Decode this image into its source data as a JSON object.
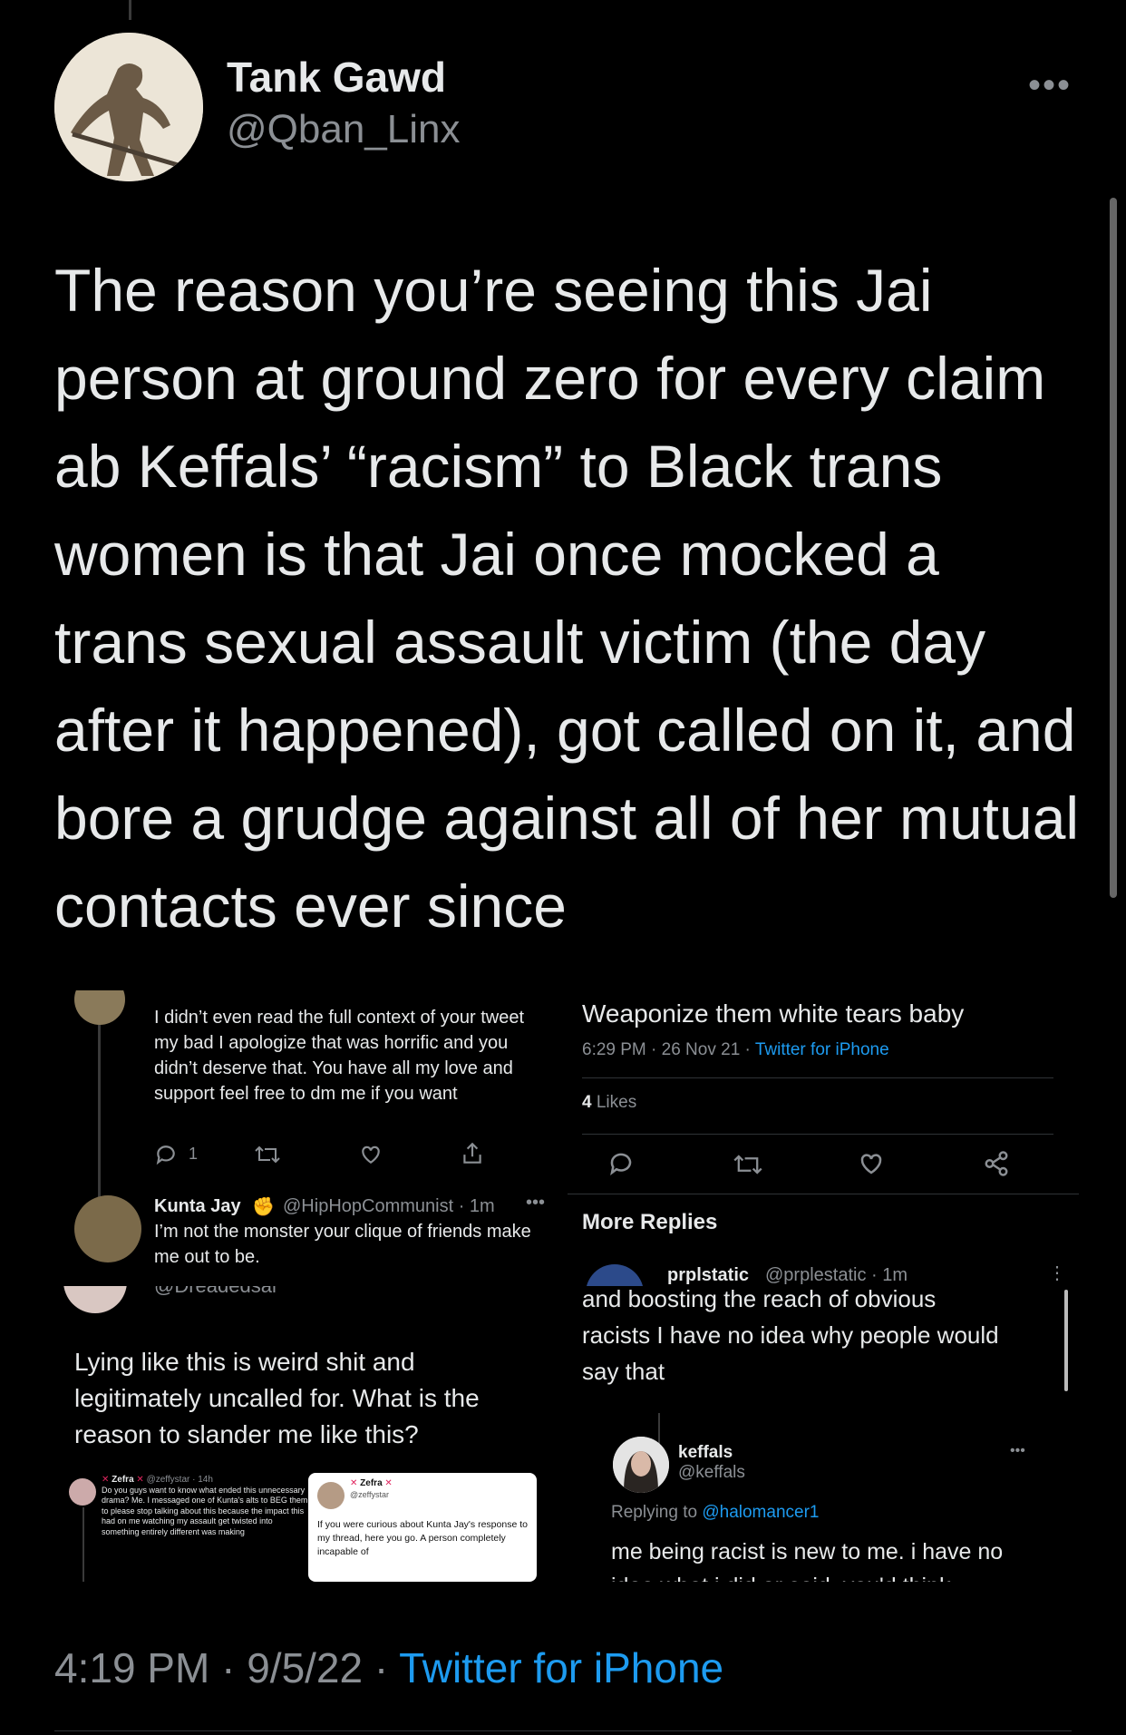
{
  "tweet": {
    "author_name": "Tank Gawd",
    "author_handle": "@Qban_Linx",
    "more": "•••",
    "text": "The reason you’re seeing this Jai person at ground zero for every claim ab Keffals’ “racism” to Black trans women is that Jai once mocked a trans sexual assault victim (the day after it happened), got called on it, and bore a grudge against all of her mutual contacts ever since",
    "time": "4:19 PM",
    "date": "9/5/22",
    "source": "Twitter for iPhone",
    "sep": "·"
  },
  "shot1": {
    "reply_text": "I didn’t even read the full context of your tweet my bad I apologize that was horrific and you didn’t deserve that. You have all my love and support feel free to dm me if you want",
    "reply_count": "1",
    "kunta_name": "Kunta Jay",
    "kunta_handle": "@HipHopCommunist · 1m",
    "kunta_more": "•••",
    "kunta_text": "I’m not the monster your clique of friends make me out to be."
  },
  "shot2": {
    "text": "Weaponize them white tears baby",
    "meta_time": "6:29 PM · 26 Nov 21 · ",
    "meta_source": "Twitter for iPhone",
    "likes_count": "4",
    "likes_label": "Likes",
    "more_replies": "More Replies",
    "prpl_name": "prplstatic",
    "prpl_handle": "@prplestatic · 1m",
    "prpl_more": "⋮"
  },
  "shot3": {
    "cut_handle": "@Dreadedsal",
    "text": "Lying like this is weird shit and legitimately uncalled for. What is the reason to slander me like this?",
    "inner_name": "Zefra",
    "inner_handle": "@zeffystar · 14h",
    "inner_text": "Do you guys want to know what ended this unnecessary drama? Me. I messaged one of Kunta's alts to BEG them to please stop talking about this because the impact this had on me watching my assault get twisted into something entirely different was making",
    "card_name": "Zefra",
    "card_handle": "@zeffystar",
    "card_text": "If you were curious about Kunta Jay's response to my thread, here you go. A person completely incapable of"
  },
  "shot4": {
    "cut_text": "and boosting the reach of obvious racists I have no idea why people would say that",
    "keffals_name": "keffals",
    "keffals_handle": "@keffals",
    "keffals_more": "•••",
    "replying_prefix": "Replying to ",
    "replying_to": "@halomancer1",
    "keffals_text": "me being racist is new to me. i have no idea what i did or said, you'd think"
  }
}
